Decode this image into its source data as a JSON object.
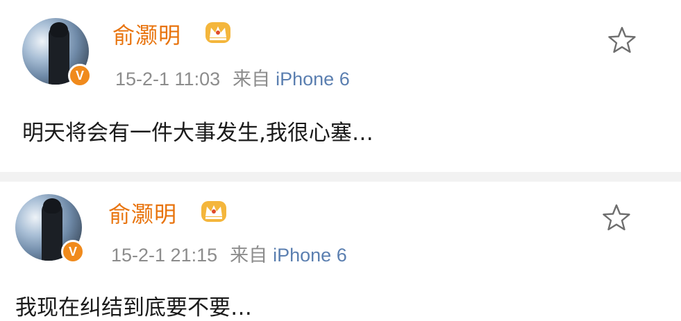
{
  "posts": [
    {
      "username": "俞灏明",
      "date": "15-2-1 11:03",
      "from_label": "来自",
      "device": "iPhone 6",
      "text": "明天将会有一件大事发生,我很心塞…"
    },
    {
      "username": "俞灏明",
      "date": "15-2-1 21:15",
      "from_label": "来自",
      "device": "iPhone 6",
      "text": "我现在纠结到底要不要…"
    }
  ],
  "badge": {
    "verified_letter": "V"
  },
  "colors": {
    "username": "#e8730c",
    "meta": "#8c8c8c",
    "device": "#5b7fb0",
    "verified": "#f08a1c",
    "crown": "#f4b63c"
  },
  "icons": {
    "avatar": "avatar",
    "verified": "verified-v-icon",
    "crown": "crown-icon",
    "favorite": "star-icon"
  }
}
